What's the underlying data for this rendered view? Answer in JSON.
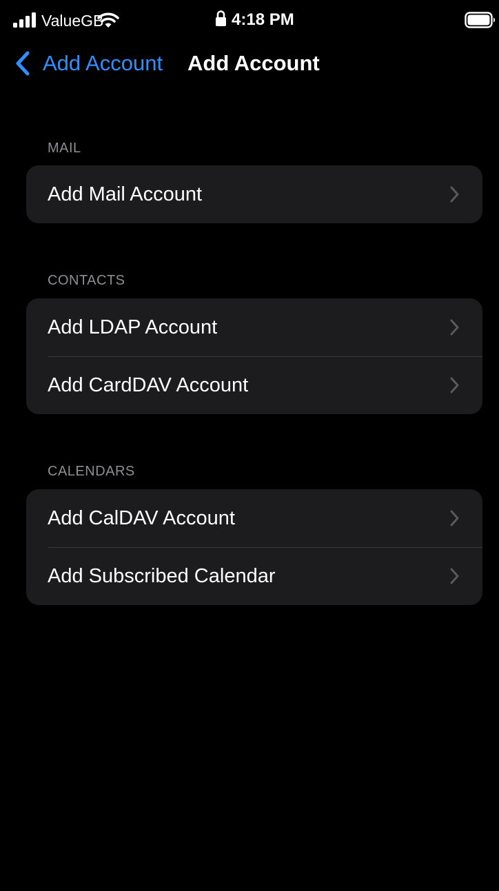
{
  "status_bar": {
    "carrier": "ValueGB",
    "time": "4:18 PM",
    "icons": [
      "signal-bars-icon",
      "wifi-icon",
      "lock-icon",
      "battery-icon"
    ]
  },
  "nav": {
    "back_label": "Add Account",
    "title": "Add Account"
  },
  "sections": [
    {
      "header": "MAIL",
      "items": [
        {
          "label": "Add Mail Account"
        }
      ]
    },
    {
      "header": "CONTACTS",
      "items": [
        {
          "label": "Add LDAP Account"
        },
        {
          "label": "Add CardDAV Account"
        }
      ]
    },
    {
      "header": "CALENDARS",
      "items": [
        {
          "label": "Add CalDAV Account"
        },
        {
          "label": "Add Subscribed Calendar"
        }
      ]
    }
  ],
  "colors": {
    "background": "#000000",
    "group_background": "#1c1c1e",
    "accent": "#2f8ffd",
    "section_header": "#8e8e93",
    "chevron": "#5a5a5e",
    "separator": "#38383a"
  }
}
